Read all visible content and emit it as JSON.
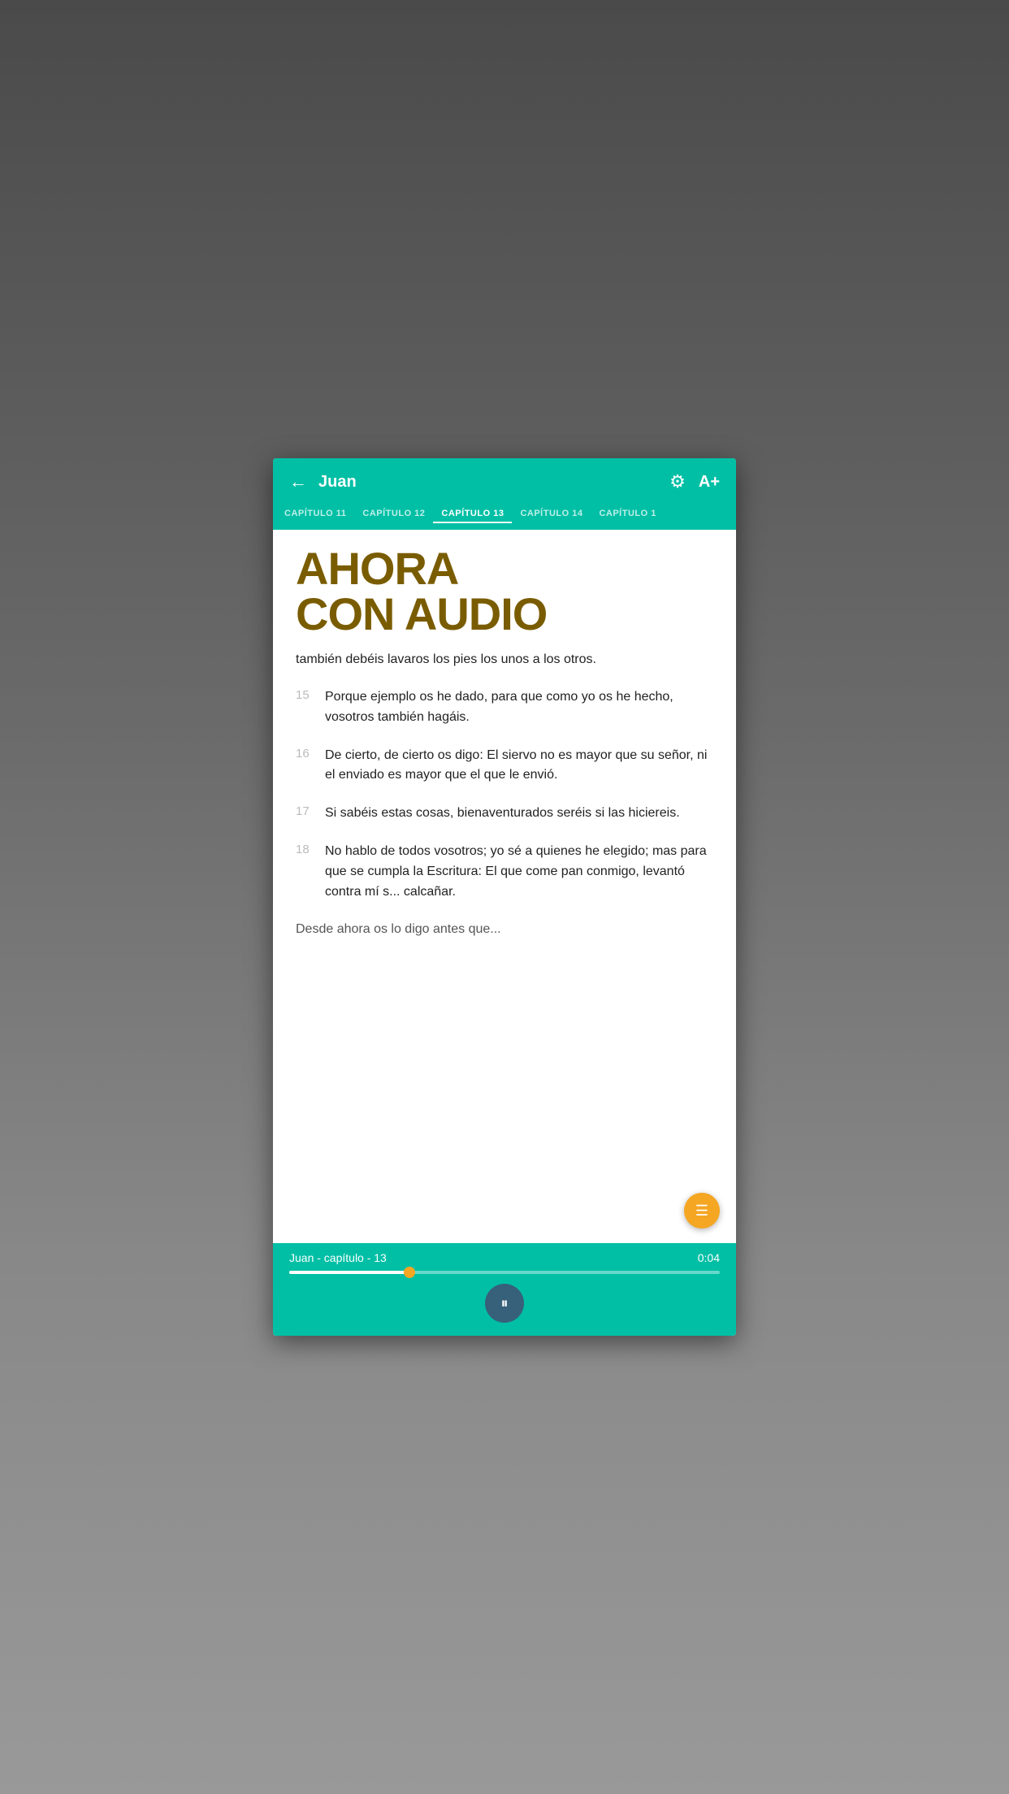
{
  "background": {
    "color": "#5a5a5a"
  },
  "header": {
    "title": "Juan",
    "back_label": "←",
    "settings_icon": "⚙",
    "font_size_label": "A+"
  },
  "chapter_tabs": [
    {
      "label": "CAPÍTULO 11",
      "active": false
    },
    {
      "label": "CAPÍTULO 12",
      "active": false
    },
    {
      "label": "CAPÍTULO 13",
      "active": true
    },
    {
      "label": "CAPÍTULO 14",
      "active": false
    },
    {
      "label": "CAPÍTULO 1",
      "active": false
    }
  ],
  "promo": {
    "line1": "AHORA",
    "line2": "CON AUDIO"
  },
  "content": {
    "intro_text": "también debéis lavaros los pies los unos a los otros.",
    "verses": [
      {
        "number": "15",
        "text": "Porque ejemplo os he dado, para que como yo os he hecho, vosotros también hagáis."
      },
      {
        "number": "16",
        "text": "De cierto, de cierto os digo: El siervo no es mayor que su señor, ni el enviado es mayor que el que le envió."
      },
      {
        "number": "17",
        "text": "Si sabéis estas cosas, bienaventurados seréis si las hiciereis."
      },
      {
        "number": "18",
        "text": "No hablo de todos vosotros; yo sé a quienes he elegido; mas para que se cumpla la Escritura: El que come pan conmigo, levantó contra mí s... calcañar."
      }
    ],
    "partial_text": "Desde ahora os lo digo antes que..."
  },
  "fab": {
    "icon": "☰"
  },
  "audio_player": {
    "title": "Juan - capítulo - 13",
    "time": "0:04",
    "progress_percent": 28,
    "pause_icon": "⏸"
  }
}
